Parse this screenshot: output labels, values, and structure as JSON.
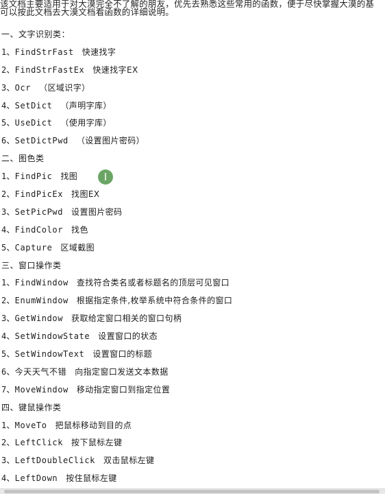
{
  "intro": {
    "line1": "该文档主要适用于对大漠完全不了解的朋友，优先去熟悉这些常用的函数，便于尽快掌握大漠的基",
    "line2": "可以按此文档去大漠文档看函数的详细说明。"
  },
  "sections": [
    {
      "heading": "一、文字识别类：",
      "items": [
        {
          "num": "1、",
          "fn": "FindStrFast",
          "desc": "快速找字"
        },
        {
          "num": "2、",
          "fn": "FindStrFastEx",
          "desc": "快速找字EX"
        },
        {
          "num": "3、",
          "fn": "Ocr",
          "desc": "（区域识字）"
        },
        {
          "num": "4、",
          "fn": "SetDict",
          "desc": "（声明字库）"
        },
        {
          "num": "5、",
          "fn": "UseDict",
          "desc": "（使用字库）"
        },
        {
          "num": "6、",
          "fn": "SetDictPwd",
          "desc": "（设置图片密码）"
        }
      ]
    },
    {
      "heading": "二、图色类",
      "items": [
        {
          "num": "1、",
          "fn": "FindPic",
          "desc": "找图"
        },
        {
          "num": "2、",
          "fn": "FindPicEx",
          "desc": "找图EX"
        },
        {
          "num": "3、",
          "fn": "SetPicPwd",
          "desc": "设置图片密码"
        },
        {
          "num": "4、",
          "fn": "FindColor",
          "desc": "找色"
        },
        {
          "num": "5、",
          "fn": "Capture",
          "desc": "区域截图"
        }
      ]
    },
    {
      "heading": "三、窗口操作类",
      "items": [
        {
          "num": "1、",
          "fn": "FindWindow",
          "desc": "查找符合类名或者标题名的顶层可见窗口"
        },
        {
          "num": "2、",
          "fn": "EnumWindow",
          "desc": "根据指定条件,枚举系统中符合条件的窗口"
        },
        {
          "num": "3、",
          "fn": "GetWindow",
          "desc": "获取给定窗口相关的窗口句柄"
        },
        {
          "num": "4、",
          "fn": "SetWindowState",
          "desc": "设置窗口的状态"
        },
        {
          "num": "5、",
          "fn": "SetWindowText",
          "desc": "设置窗口的标题"
        },
        {
          "num": "6、",
          "fn": "今天天气不错",
          "desc": "向指定窗口发送文本数据"
        },
        {
          "num": "7、",
          "fn": "MoveWindow",
          "desc": "移动指定窗口到指定位置"
        }
      ]
    },
    {
      "heading": "四、键鼠操作类",
      "items": [
        {
          "num": "1、",
          "fn": "MoveTo",
          "desc": "把鼠标移动到目的点"
        },
        {
          "num": "2、",
          "fn": "LeftClick",
          "desc": "按下鼠标左键"
        },
        {
          "num": "3、",
          "fn": "LeftDoubleClick",
          "desc": "双击鼠标左键"
        },
        {
          "num": "4、",
          "fn": "LeftDown",
          "desc": "按住鼠标左键"
        }
      ]
    }
  ],
  "cursor": {
    "icon": "text-cursor-highlight-icon",
    "color": "#5f9e58"
  }
}
